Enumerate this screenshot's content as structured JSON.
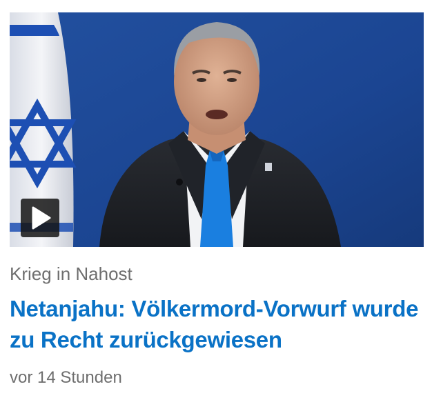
{
  "article": {
    "kicker": "Krieg in Nahost",
    "headline": "Netanjahu: Völkermord-Vorwurf wurde zu Recht zurückgewiesen",
    "timestamp": "vor 14 Stunden"
  },
  "media": {
    "type": "video",
    "play_icon": "play-icon"
  },
  "colors": {
    "headline": "#0a72c6",
    "meta_text": "#6e6e6e",
    "background": "#ffffff"
  }
}
